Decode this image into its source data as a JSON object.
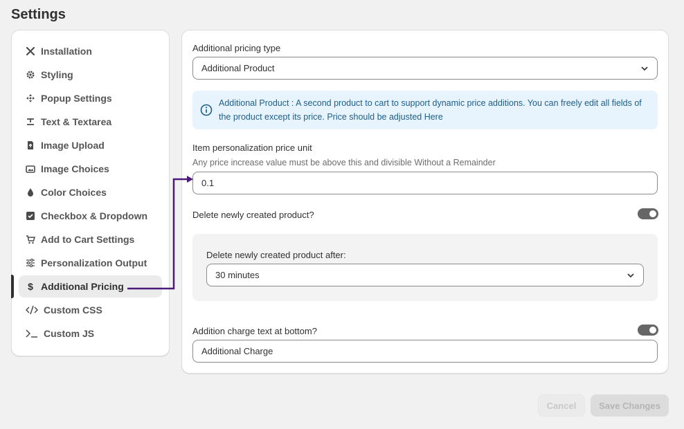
{
  "page": {
    "title": "Settings"
  },
  "sidebar": {
    "items": [
      {
        "label": "Installation",
        "icon": "tools-icon"
      },
      {
        "label": "Styling",
        "icon": "gear-icon"
      },
      {
        "label": "Popup Settings",
        "icon": "move-icon"
      },
      {
        "label": "Text & Textarea",
        "icon": "text-icon"
      },
      {
        "label": "Image Upload",
        "icon": "file-upload-icon"
      },
      {
        "label": "Image Choices",
        "icon": "images-icon"
      },
      {
        "label": "Color Choices",
        "icon": "droplet-icon"
      },
      {
        "label": "Checkbox & Dropdown",
        "icon": "checkbox-icon"
      },
      {
        "label": "Add to Cart Settings",
        "icon": "cart-icon"
      },
      {
        "label": "Personalization Output",
        "icon": "sliders-icon"
      },
      {
        "label": "Additional Pricing",
        "icon": "dollar-icon",
        "active": true
      },
      {
        "label": "Custom CSS",
        "icon": "code-icon"
      },
      {
        "label": "Custom JS",
        "icon": "terminal-icon"
      }
    ]
  },
  "form": {
    "pricing_type": {
      "label": "Additional pricing type",
      "value": "Additional Product"
    },
    "info": {
      "text": "Additional Product : A second product to cart to support dynamic price additions. You can freely edit all fields of the product except its price. Price should be adjusted Here"
    },
    "price_unit": {
      "label": "Item personalization price unit",
      "help": "Any price increase value must be above this and divisible Without a Remainder",
      "value": "0.1"
    },
    "delete_product": {
      "label": "Delete newly created product?",
      "enabled": true
    },
    "delete_after": {
      "label": "Delete newly created product after:",
      "value": "30 minutes"
    },
    "charge_text": {
      "label": "Addition charge text at bottom?",
      "enabled": true,
      "value": "Additional Charge"
    }
  },
  "actions": {
    "cancel_label": "Cancel",
    "save_label": "Save Changes"
  },
  "colors": {
    "accent_arrow": "#4b1a7a",
    "info_bg": "#e7f3fd",
    "info_text": "#1d5f8a"
  }
}
